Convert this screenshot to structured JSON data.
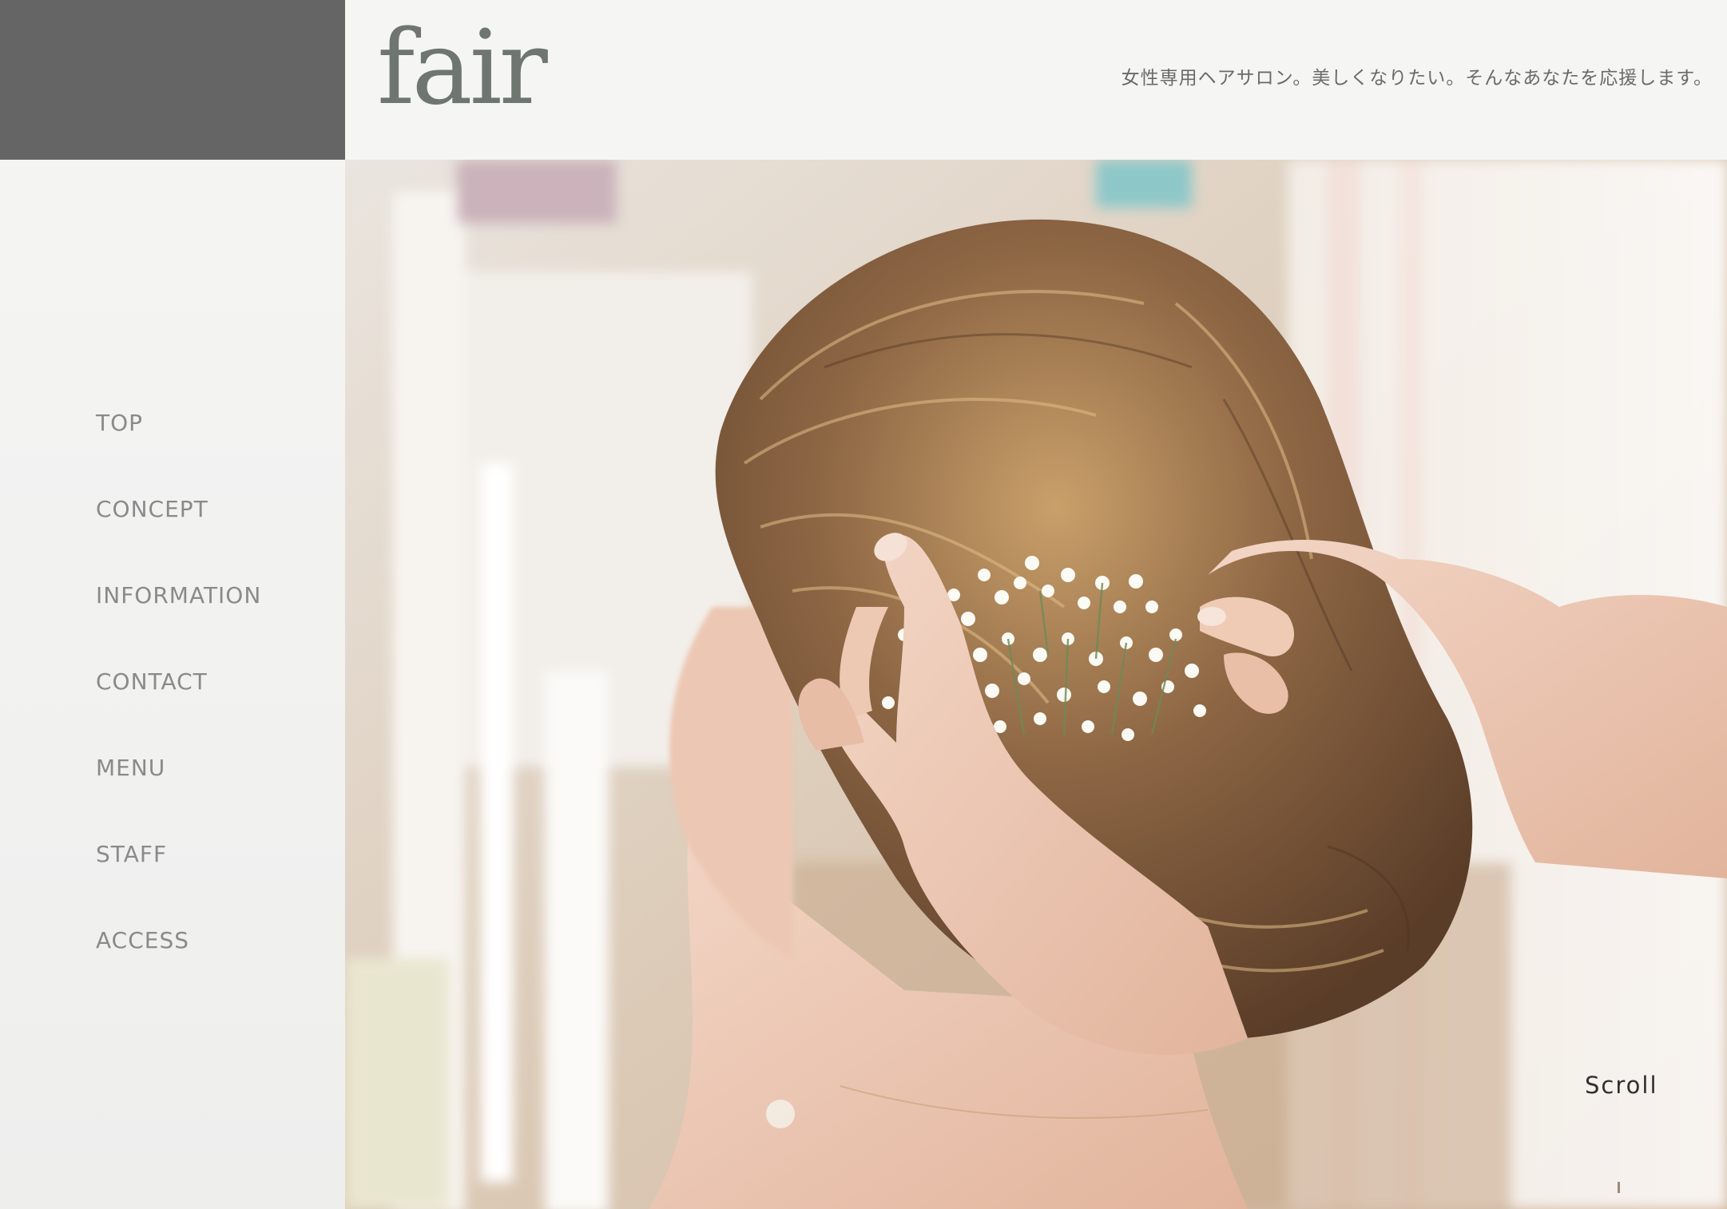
{
  "site": {
    "logo_text": "fair",
    "tagline": "女性専用ヘアサロン。美しくなりたい。そんなあなたを応援します。"
  },
  "nav": {
    "items": [
      {
        "label": "TOP"
      },
      {
        "label": "CONCEPT"
      },
      {
        "label": "INFORMATION"
      },
      {
        "label": "CONTACT"
      },
      {
        "label": "MENU"
      },
      {
        "label": "STAFF"
      },
      {
        "label": "ACCESS"
      }
    ]
  },
  "hero": {
    "scroll_label": "Scroll"
  },
  "colors": {
    "sidebar_header_bg": "#656565",
    "page_bg": "#f3f3f2",
    "nav_text": "#8a8a8a",
    "logo": "#6f756f",
    "tagline_text": "#6a6a6a"
  }
}
